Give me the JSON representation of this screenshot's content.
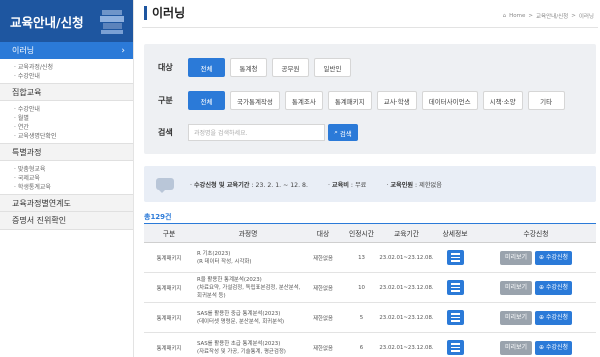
{
  "sidebar": {
    "header": "교육안내/신청",
    "active_item": "이러닝",
    "active_subitems": [
      "교육과정/신청",
      "수강안내"
    ],
    "sections": [
      {
        "label": "집합교육",
        "subitems": [
          "수강안내",
          "월별",
          "연간",
          "교육생명단확인"
        ]
      },
      {
        "label": "특별과정",
        "subitems": [
          "맞춤형교육",
          "국제교육",
          "학생통계교육"
        ]
      },
      {
        "label": "교육과정별연계도",
        "subitems": []
      },
      {
        "label": "증명서 진위확인",
        "subitems": []
      }
    ]
  },
  "page": {
    "title": "이러닝",
    "breadcrumb": [
      "Home",
      "교육안내/신청",
      "이러닝"
    ]
  },
  "filter": {
    "target_label": "대상",
    "target_options": [
      "전체",
      "통계청",
      "공무원",
      "일반인"
    ],
    "target_selected": 0,
    "category_label": "구분",
    "category_options": [
      "전체",
      "국가통계작성",
      "통계조사",
      "통계패키지",
      "교사·학생",
      "데이터사이언스",
      "시책·소양",
      "기타"
    ],
    "category_selected": 0,
    "search_label": "검색",
    "search_placeholder": "과정명을 검색하세요.",
    "search_button": "검색"
  },
  "info": {
    "period_label": "수강신청 및 교육기간",
    "period_value": "23. 2. 1. ~ 12. 8.",
    "fee_label": "교육비",
    "fee_value": "무료",
    "quota_label": "교육인원",
    "quota_value": "제한없음"
  },
  "total": "총129건",
  "table": {
    "headers": [
      "구분",
      "과정명",
      "대상",
      "인정시간",
      "교육기간",
      "상세정보",
      "수강신청"
    ],
    "rows": [
      {
        "category": "통계패키지",
        "title": "R 기초(2023)",
        "subtitle": "(R 데이터 작성, 시각화)",
        "target": "제한없음",
        "hours": "13",
        "period": "23.02.01~23.12.08."
      },
      {
        "category": "통계패키지",
        "title": "R을 활용한 통계분석(2023)",
        "subtitle": "(차료요약, 가설검정, 독립표본검정, 분산분석, 회귀분석 등)",
        "target": "제한없음",
        "hours": "10",
        "period": "23.02.01~23.12.08."
      },
      {
        "category": "통계패키지",
        "title": "SAS를 활용한 중급 통계분석(2023)",
        "subtitle": "(데이터셋 명령문, 분산분석, 회귀분석)",
        "target": "제한없음",
        "hours": "5",
        "period": "23.02.01~23.12.08."
      },
      {
        "category": "통계패키지",
        "title": "SAS를 활용한 초급 통계분석(2023)",
        "subtitle": "(자료작성 및 가공, 기술통계, 평균검정)",
        "target": "제한없음",
        "hours": "6",
        "period": "23.02.01~23.12.08."
      }
    ],
    "preview_label": "미리보기",
    "apply_label": "수강신청"
  }
}
